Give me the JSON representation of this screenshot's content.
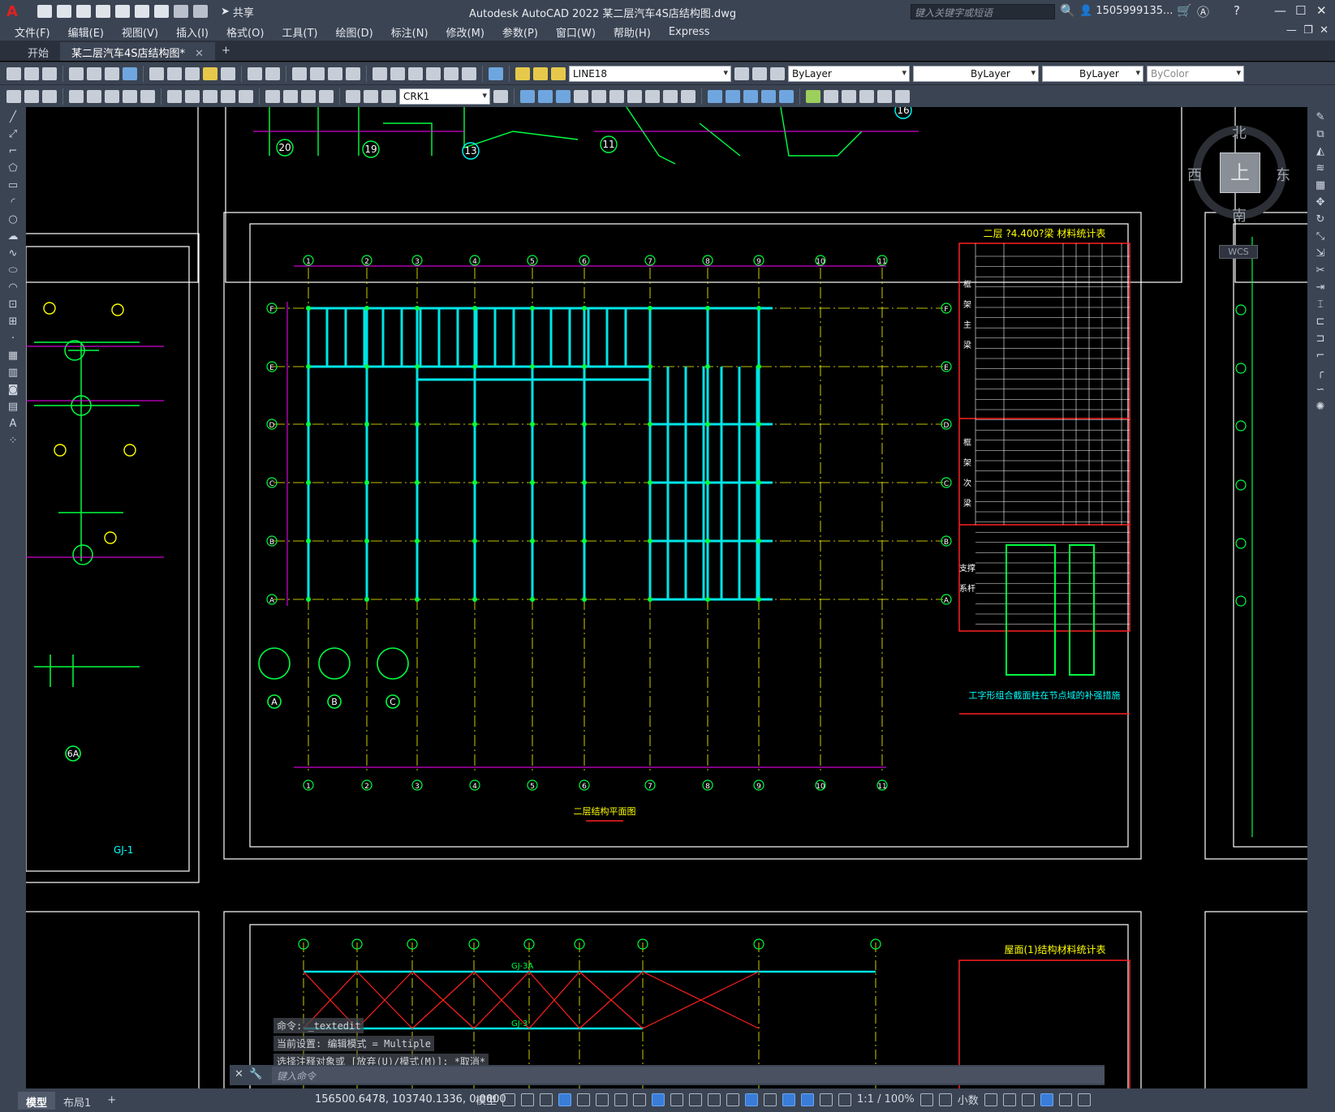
{
  "app": {
    "title": "Autodesk AutoCAD 2022    某二层汽车4S店结构图.dwg",
    "share": "共享",
    "search_placeholder": "键入关键字或短语",
    "user": "1505999135...",
    "logo": "A"
  },
  "menu": [
    "文件(F)",
    "编辑(E)",
    "视图(V)",
    "插入(I)",
    "格式(O)",
    "工具(T)",
    "绘图(D)",
    "标注(N)",
    "修改(M)",
    "参数(P)",
    "窗口(W)",
    "帮助(H)",
    "Express"
  ],
  "tabs": [
    {
      "label": "开始"
    },
    {
      "label": "某二层汽车4S店结构图*"
    }
  ],
  "toolbar": {
    "layer": "LINE18",
    "color": "ByLayer",
    "linetype": "ByLayer",
    "lineweight": "ByLayer",
    "plotstyle": "ByColor",
    "dimstyle": "CRK1"
  },
  "viewcube": {
    "top": "上",
    "north": "北",
    "south": "南",
    "east": "东",
    "west": "西",
    "wcs": "WCS"
  },
  "drawing": {
    "main_title": "二层 ?4.400?梁  材料统计表",
    "plan_title": "二层结构平面图",
    "detail_title": "工字形组合截面柱在节点域的补强措施",
    "roof_title": "屋面(1)结构材料统计表",
    "gj1": "GJ-1",
    "gj3a": "GJ-3A",
    "gj3": "GJ-3",
    "bubble_top": [
      "20",
      "19",
      "13",
      "11",
      "16"
    ],
    "section_marks": [
      "A",
      "B",
      "C",
      "6A"
    ],
    "col_axes": [
      "1",
      "2",
      "3",
      "4",
      "5",
      "6",
      "7",
      "8",
      "9",
      "10",
      "11"
    ],
    "row_axes": [
      "F",
      "E",
      "D",
      "C",
      "B",
      "A"
    ],
    "table_groups": [
      "框",
      "架",
      "主",
      "梁",
      "框",
      "架",
      "次",
      "梁",
      "支撑",
      "系杆"
    ]
  },
  "command": {
    "history": [
      "命令: _textedit",
      "当前设置: 编辑模式 = Multiple",
      "选择注释对象或 [放弃(U)/模式(M)]: *取消*"
    ],
    "placeholder": "键入命令"
  },
  "status": {
    "layout_tabs": [
      "模型",
      "布局1"
    ],
    "coords": "156500.6478, 103740.1336, 0.0000",
    "space": "模型",
    "scale": "1:1 / 100%",
    "units": "小数"
  }
}
